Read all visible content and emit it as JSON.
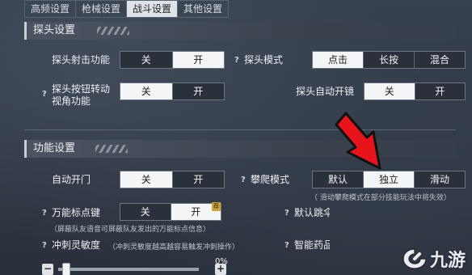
{
  "tabs": [
    {
      "label": "高频设置"
    },
    {
      "label": "枪械设置"
    },
    {
      "label": "战斗设置"
    },
    {
      "label": "其他设置"
    }
  ],
  "peek_section": {
    "title": "探头设置",
    "peek_fire": {
      "label": "探头射击功能",
      "off": "关",
      "on": "开",
      "selected": "开"
    },
    "peek_mode": {
      "help": "?",
      "label": "探头模式",
      "options": [
        "点击",
        "长按",
        "混合"
      ],
      "selected": "点击"
    },
    "peek_turn": {
      "help": "?",
      "label_line1": "探头按钮转动",
      "label_line2": "视角功能",
      "off": "关",
      "on": "开",
      "selected": "关"
    },
    "peek_auto_scope": {
      "label": "探头自动开镜",
      "off": "关",
      "on": "开",
      "selected": "关"
    }
  },
  "function_section": {
    "title": "功能设置",
    "auto_door": {
      "label": "自动开门",
      "off": "关",
      "on": "开",
      "selected": "关"
    },
    "climb_mode": {
      "help": "?",
      "label": "攀爬模式",
      "options": [
        "默认",
        "独立",
        "滑动"
      ],
      "selected": "独立",
      "note": "（ 滑动攀爬模式在部分技能玩法中将失效）"
    },
    "marker_key": {
      "help": "?",
      "label": "万能标点键",
      "off": "关",
      "on": "开",
      "selected": "开",
      "badge": "荐",
      "note": "（屏蔽队友语音可屏蔽队友发出的万能标点信息）"
    },
    "default_jump": {
      "help": "?",
      "label": "默认跳伞"
    },
    "sprint_sensitivity": {
      "help": "?",
      "label": "冲刺灵敏度",
      "note": "（冲刺灵敏度越高越容易触发冲刺操作）",
      "percent_label": "0%",
      "value": 0.03,
      "minus": "−",
      "plus": "+"
    },
    "smart_medicine": {
      "help": "?",
      "label": "智能药品"
    }
  },
  "annotation": {
    "color": "#e8141b"
  },
  "watermark": {
    "text": "九游"
  }
}
